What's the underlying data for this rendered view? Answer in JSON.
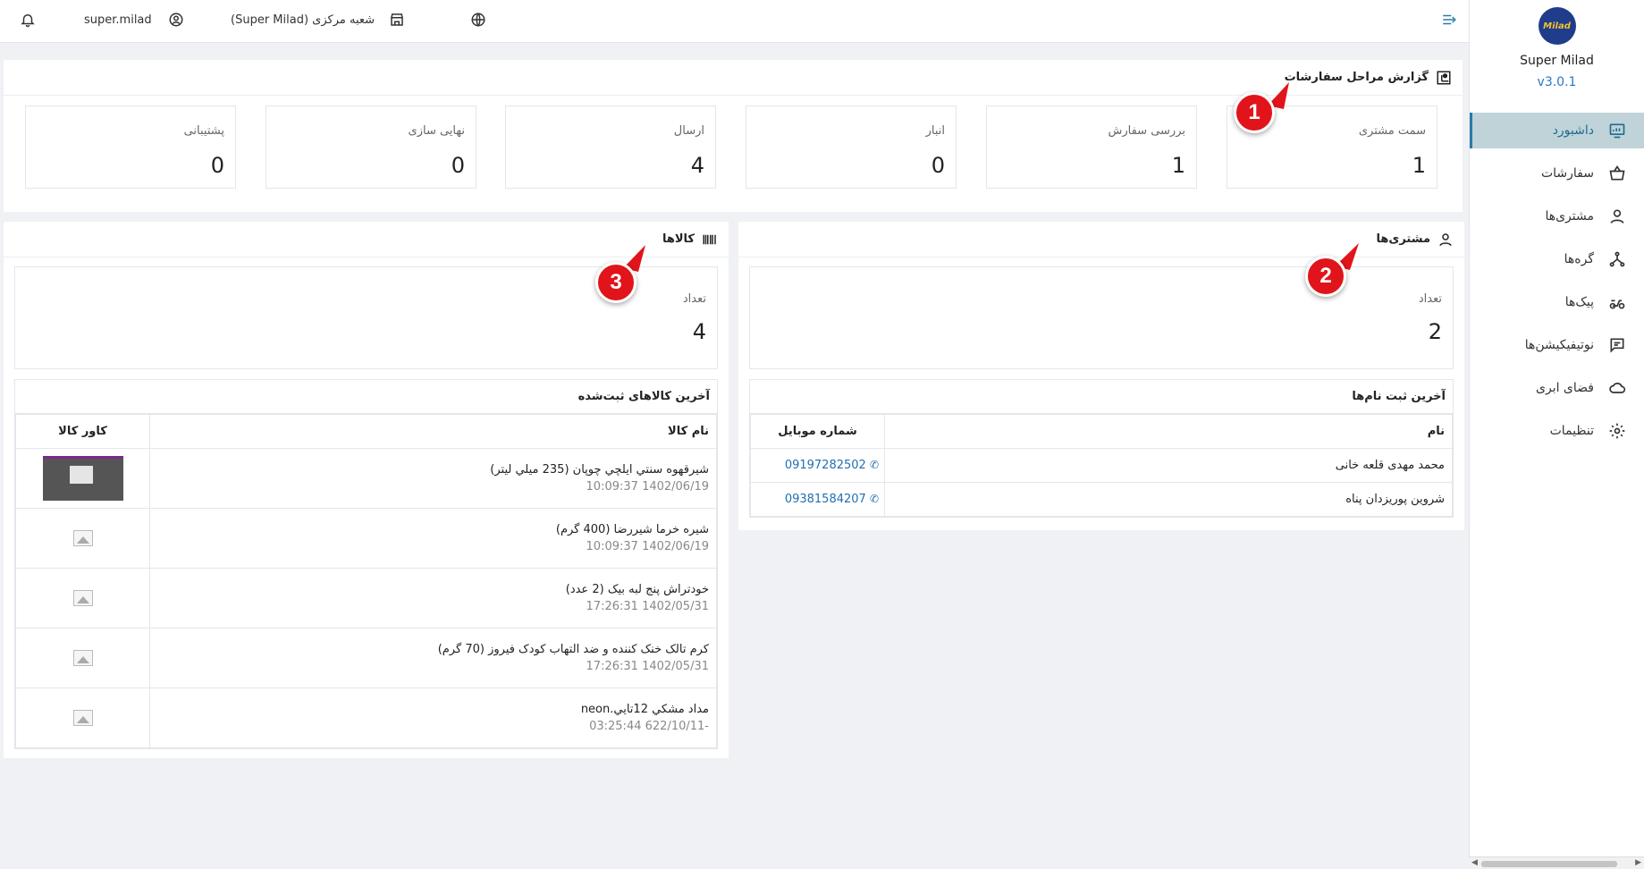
{
  "topbar": {
    "username": "super.milad",
    "branch": "شعبه مرکزی (Super Milad)"
  },
  "sidebar": {
    "brand_name": "Super Milad",
    "version": "v3.0.1",
    "logo_text": "Milad",
    "items": [
      {
        "label": "داشبورد",
        "icon": "dashboard-icon",
        "active": true
      },
      {
        "label": "سفارشات",
        "icon": "basket-icon",
        "active": false
      },
      {
        "label": "مشتری‌ها",
        "icon": "user-icon",
        "active": false
      },
      {
        "label": "گره‌ها",
        "icon": "nodes-icon",
        "active": false
      },
      {
        "label": "پیک‌ها",
        "icon": "courier-icon",
        "active": false
      },
      {
        "label": "نوتیفیکیشن‌ها",
        "icon": "message-icon",
        "active": false
      },
      {
        "label": "فضای ابری",
        "icon": "cloud-icon",
        "active": false
      },
      {
        "label": "تنظیمات",
        "icon": "gear-icon",
        "active": false
      }
    ]
  },
  "orders_report": {
    "title": "گزارش مراحل سفارشات",
    "stages": [
      {
        "label": "سمت مشتری",
        "value": "1"
      },
      {
        "label": "بررسی سفارش",
        "value": "1"
      },
      {
        "label": "انبار",
        "value": "0"
      },
      {
        "label": "ارسال",
        "value": "4"
      },
      {
        "label": "نهایی سازی",
        "value": "0"
      },
      {
        "label": "پشتیبانی",
        "value": "0"
      }
    ]
  },
  "customers": {
    "title": "مشتری‌ها",
    "count_label": "تعداد",
    "count": "2",
    "latest_title": "آخرین ثبت نام‌ها",
    "col_name": "نام",
    "col_mobile": "شماره موبایل",
    "rows": [
      {
        "name": "محمد مهدی قلعه خانی",
        "mobile": "09197282502"
      },
      {
        "name": "شروین پوریزدان پناه",
        "mobile": "09381584207"
      }
    ]
  },
  "products": {
    "title": "کالاها",
    "count_label": "تعداد",
    "count": "4",
    "latest_title": "آخرین کالاهای ثبت‌شده",
    "col_name": "نام کالا",
    "col_cover": "کاور کالا",
    "rows": [
      {
        "name": "شيرقهوه سنتي ايلچي چوپان (235 ميلي ليتر)",
        "date": "1402/06/19 10:09:37",
        "has_image": true
      },
      {
        "name": "شیره خرما شیررضا (400 گرم)",
        "date": "1402/06/19 10:09:37",
        "has_image": false
      },
      {
        "name": "خودتراش پنج لبه بیک (2 عدد)",
        "date": "1402/05/31 17:26:31",
        "has_image": false
      },
      {
        "name": "کرم تالک خنک کننده و ضد التهاب کودک فیروز (70 گرم)",
        "date": "1402/05/31 17:26:31",
        "has_image": false
      },
      {
        "name": "مداد مشكي 12تايي.neon",
        "date": "-622/10/11 03:25:44",
        "has_image": false
      }
    ]
  },
  "markers": [
    "1",
    "2",
    "3"
  ],
  "colors": {
    "accent": "#2b7aa6",
    "active_bg": "#bfd3d9",
    "link": "#1f6fb2",
    "marker": "#e1141b",
    "background": "#f0f1f5"
  }
}
